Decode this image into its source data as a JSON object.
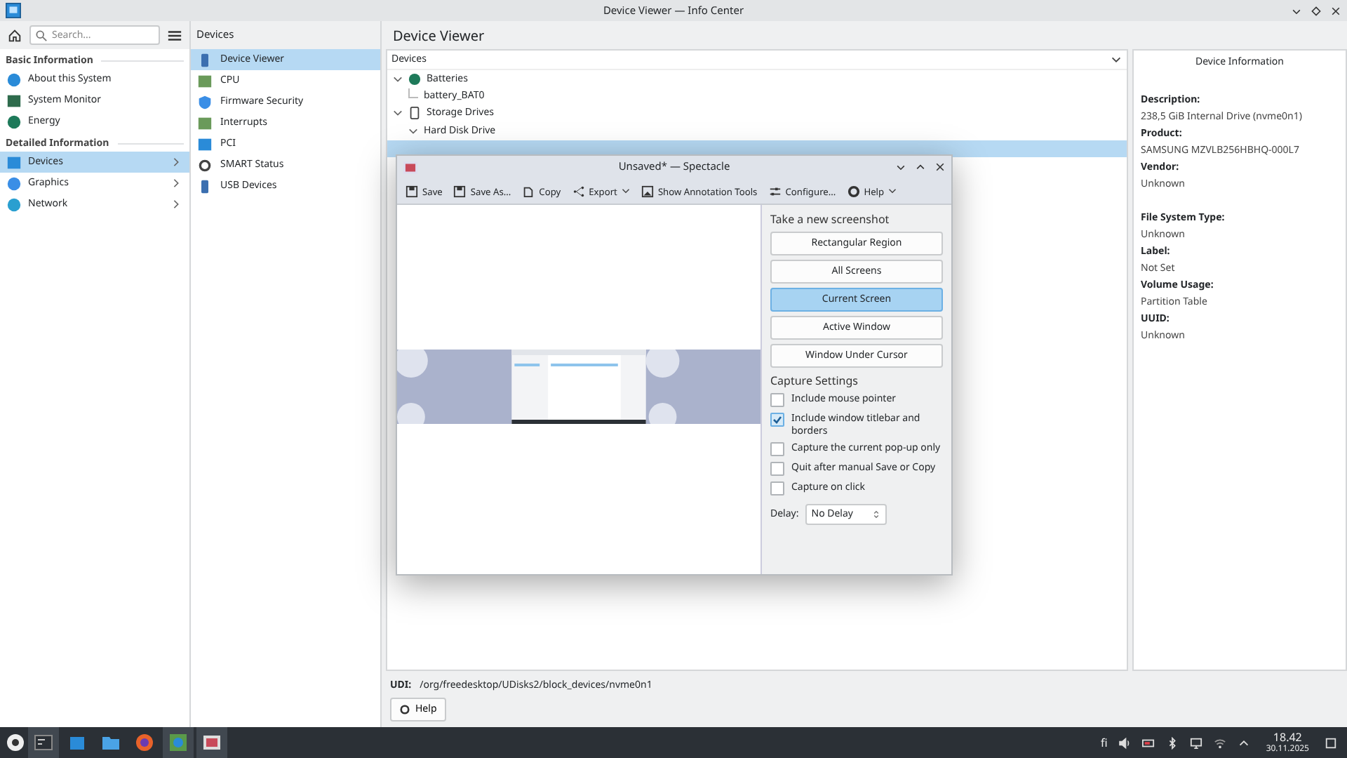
{
  "window": {
    "title": "Device Viewer — Info Center"
  },
  "sidebar": {
    "search": {
      "placeholder": "Search..."
    },
    "sections": [
      {
        "title": "Basic Information",
        "items": [
          {
            "label": "About this System",
            "selected": false,
            "has_children": false
          },
          {
            "label": "System Monitor",
            "selected": false,
            "has_children": false
          },
          {
            "label": "Energy",
            "selected": false,
            "has_children": false
          }
        ]
      },
      {
        "title": "Detailed Information",
        "items": [
          {
            "label": "Devices",
            "selected": true,
            "has_children": true
          },
          {
            "label": "Graphics",
            "selected": false,
            "has_children": true
          },
          {
            "label": "Network",
            "selected": false,
            "has_children": true
          }
        ]
      }
    ]
  },
  "subpanel": {
    "title": "Devices",
    "items": [
      {
        "label": "Device Viewer",
        "selected": true
      },
      {
        "label": "CPU",
        "selected": false
      },
      {
        "label": "Firmware Security",
        "selected": false
      },
      {
        "label": "Interrupts",
        "selected": false
      },
      {
        "label": "PCI",
        "selected": false
      },
      {
        "label": "SMART Status",
        "selected": false
      },
      {
        "label": "USB Devices",
        "selected": false
      }
    ]
  },
  "main": {
    "title": "Device Viewer",
    "tree": {
      "header": "Devices",
      "items": [
        {
          "label": "Batteries",
          "expanded": true,
          "selected": false,
          "children": [
            {
              "label": "battery_BAT0",
              "selected": false
            }
          ]
        },
        {
          "label": "Storage Drives",
          "expanded": true,
          "selected": false,
          "children": [
            {
              "label": "Hard Disk Drive",
              "expanded": true,
              "selected": false,
              "children": [
                {
                  "selected": true
                }
              ]
            }
          ]
        }
      ]
    },
    "info": {
      "title": "Device Information",
      "groups": [
        [
          {
            "label": "Description:",
            "value": "238,5 GiB Internal Drive (nvme0n1)"
          },
          {
            "label": "Product:",
            "value": "SAMSUNG MZVLB256HBHQ-000L7"
          },
          {
            "label": "Vendor:",
            "value": "Unknown"
          }
        ],
        [
          {
            "label": "File System Type:",
            "value": "Unknown"
          },
          {
            "label": "Label:",
            "value": "Not Set"
          },
          {
            "label": "Volume Usage:",
            "value": "Partition Table"
          },
          {
            "label": "UUID:",
            "value": "Unknown"
          }
        ]
      ]
    },
    "udi": {
      "label": "UDI:",
      "value": "/org/freedesktop/UDisks2/block_devices/nvme0n1"
    },
    "help_button": "Help"
  },
  "dialog": {
    "title": "Unsaved* — Spectacle",
    "toolbar": [
      {
        "label": "Save",
        "menu": false
      },
      {
        "label": "Save As...",
        "menu": false
      },
      {
        "label": "Copy",
        "menu": false
      },
      {
        "label": "Export",
        "menu": true
      },
      {
        "label": "Show Annotation Tools",
        "menu": false
      },
      {
        "label": "Configure...",
        "menu": false
      },
      {
        "label": "Help",
        "menu": true
      }
    ],
    "capture_title": "Take a new screenshot",
    "modes": [
      {
        "label": "Rectangular Region",
        "selected": false
      },
      {
        "label": "All Screens",
        "selected": false
      },
      {
        "label": "Current Screen",
        "selected": true
      },
      {
        "label": "Active Window",
        "selected": false
      },
      {
        "label": "Window Under Cursor",
        "selected": false
      }
    ],
    "settings_title": "Capture Settings",
    "settings": [
      {
        "label": "Include mouse pointer",
        "checked": false
      },
      {
        "label": "Include window titlebar and borders",
        "checked": true
      },
      {
        "label": "Capture the current pop-up only",
        "checked": false
      },
      {
        "label": "Quit after manual Save or Copy",
        "checked": false
      },
      {
        "label": "Capture on click",
        "checked": false
      }
    ],
    "delay": {
      "label": "Delay:",
      "value": "No Delay"
    }
  },
  "taskbar": {
    "apps": [
      {
        "active": true
      },
      {
        "active": false
      },
      {
        "active": false
      },
      {
        "active": false
      },
      {
        "active": true
      },
      {
        "active": true
      }
    ],
    "keyboard_layout": "fi",
    "time": "18.42",
    "date": "30.11.2025"
  }
}
